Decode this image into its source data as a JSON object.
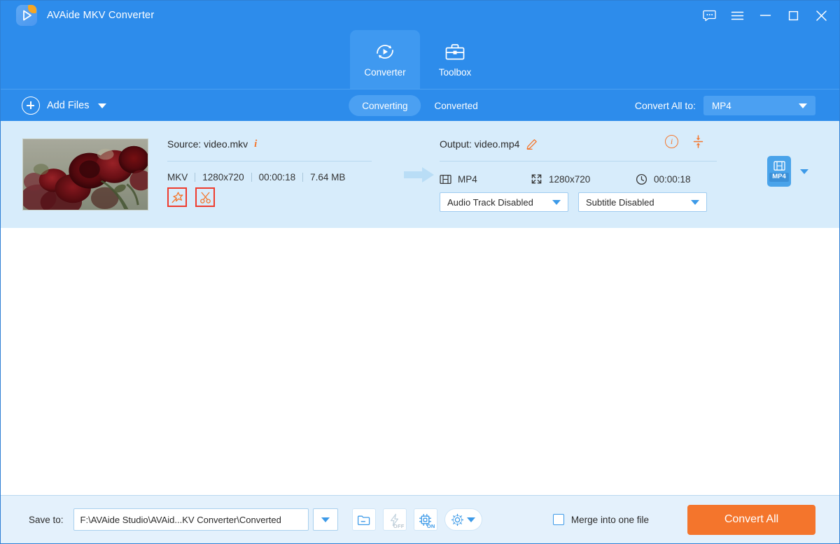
{
  "window": {
    "app_title": "AVAide MKV Converter",
    "controls": [
      {
        "name": "feedback",
        "icon": "chat-bubble-icon"
      },
      {
        "name": "menu",
        "icon": "hamburger-menu-icon"
      },
      {
        "name": "minimize",
        "icon": "minimize-icon"
      },
      {
        "name": "maximize",
        "icon": "maximize-icon"
      },
      {
        "name": "close",
        "icon": "close-icon"
      }
    ]
  },
  "nav": {
    "tabs": [
      {
        "label": "Converter",
        "icon": "convert-circular-arrows-icon",
        "active": true
      },
      {
        "label": "Toolbox",
        "icon": "toolbox-icon",
        "active": false
      }
    ]
  },
  "toolbar": {
    "add_files_label": "Add Files",
    "add_files_icon": "plus-circle-icon",
    "segments": [
      {
        "label": "Converting",
        "active": true
      },
      {
        "label": "Converted",
        "active": false
      }
    ],
    "convert_all_to_label": "Convert All to:",
    "format_value": "MP4"
  },
  "file_row": {
    "thumbnail_alt": "red-roses-video-thumbnail",
    "source": {
      "title": "Source: video.mkv",
      "info_icon": "info-italic-icon",
      "format": "MKV",
      "resolution": "1280x720",
      "duration": "00:00:18",
      "size": "7.64 MB",
      "edit_buttons": [
        {
          "name": "edit-magic-wand-button",
          "icon": "magic-wand-star-icon",
          "highlighted": true
        },
        {
          "name": "trim-scissors-button",
          "icon": "scissors-icon",
          "highlighted": true
        }
      ]
    },
    "output": {
      "title": "Output: video.mp4",
      "rename_icon": "pencil-edit-icon",
      "info_icon": "info-circle-icon",
      "merge_icon": "merge-arrows-icon",
      "format": "MP4",
      "format_icon": "film-strip-icon",
      "resolution": "1280x720",
      "resolution_icon": "resize-expand-icon",
      "duration": "00:00:18",
      "duration_icon": "clock-icon",
      "audio_track": "Audio Track Disabled",
      "subtitle": "Subtitle Disabled"
    },
    "badge": {
      "label": "MP4",
      "icon": "film-strip-icon"
    },
    "arrow_icon": "right-arrow-icon"
  },
  "bottom": {
    "save_to_label": "Save to:",
    "save_to_path": "F:\\AVAide Studio\\AVAid...KV Converter\\Converted",
    "buttons": [
      {
        "name": "open-folder-button",
        "icon": "folder-icon"
      },
      {
        "name": "hardware-acceleration-button",
        "icon": "lightning-bolt-icon",
        "state": "OFF"
      },
      {
        "name": "gpu-acceleration-button",
        "icon": "cpu-chip-icon",
        "state": "ON"
      },
      {
        "name": "preferences-button",
        "icon": "gear-icon"
      }
    ],
    "merge_label": "Merge into one file",
    "merge_checked": false,
    "convert_all_label": "Convert All"
  },
  "colors": {
    "header_blue": "#2d8ceb",
    "accent_orange": "#f4752c",
    "row_blue": "#d7ecfb",
    "highlight_red": "#ef3b2d"
  }
}
